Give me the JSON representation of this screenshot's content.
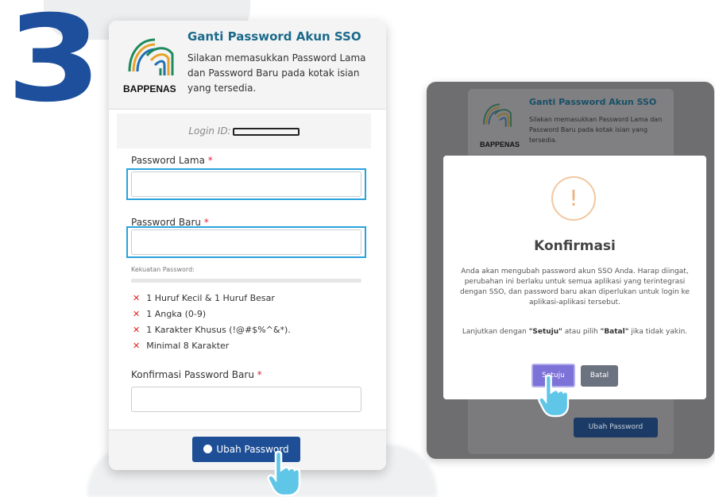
{
  "step": {
    "number": "3"
  },
  "form": {
    "logo_text": "BAPPENAS",
    "title": "Ganti Password Akun SSO",
    "description": "Silakan memasukkan Password Lama dan Password Baru pada kotak isian yang tersedia.",
    "login_id_label": "Login ID:",
    "old_password_label": "Password Lama",
    "new_password_label": "Password Baru",
    "strength_label": "Kekuatan Password:",
    "rules": [
      "1 Huruf Kecil & 1 Huruf Besar",
      "1 Angka (0-9)",
      "1 Karakter Khusus (!@#$%^&*).",
      "Minimal 8 Karakter"
    ],
    "confirm_label": "Konfirmasi Password Baru",
    "required_mark": "*",
    "submit_label": "Ubah Password"
  },
  "background_form": {
    "logo_text": "BAPPENAS",
    "title": "Ganti Password Akun SSO",
    "description": "Silakan memasukkan Password Lama dan Password Baru pada kotak isian yang tersedia.",
    "submit_label": "Ubah Password"
  },
  "modal": {
    "icon_symbol": "!",
    "title": "Konfirmasi",
    "body": "Anda akan mengubah password akun SSO Anda. Harap diingat, perubahan ini berlaku untuk semua aplikasi yang terintegrasi dengan SSO, dan password baru akan diperlukan untuk login ke aplikasi-aplikasi tersebut.",
    "prompt_prefix": "Lanjutkan dengan ",
    "prompt_agree": "\"Setuju\"",
    "prompt_middle": " atau pilih ",
    "prompt_cancel": "\"Batal\"",
    "prompt_suffix": " jika tidak yakin.",
    "ok_label": "Setuju",
    "cancel_label": "Batal"
  },
  "colors": {
    "step_number": "#1d4f9c",
    "title": "#1b6a8a",
    "primary_button": "#1e4f96",
    "highlight_border": "#2aa3dc",
    "error_x": "#e02020",
    "ok_button": "#7d72d8",
    "cancel_button": "#6b7280"
  },
  "icons": [
    "bappenas-logo",
    "x-mark-icon",
    "fingerprint-icon",
    "warning-icon",
    "hand-cursor-icon"
  ]
}
